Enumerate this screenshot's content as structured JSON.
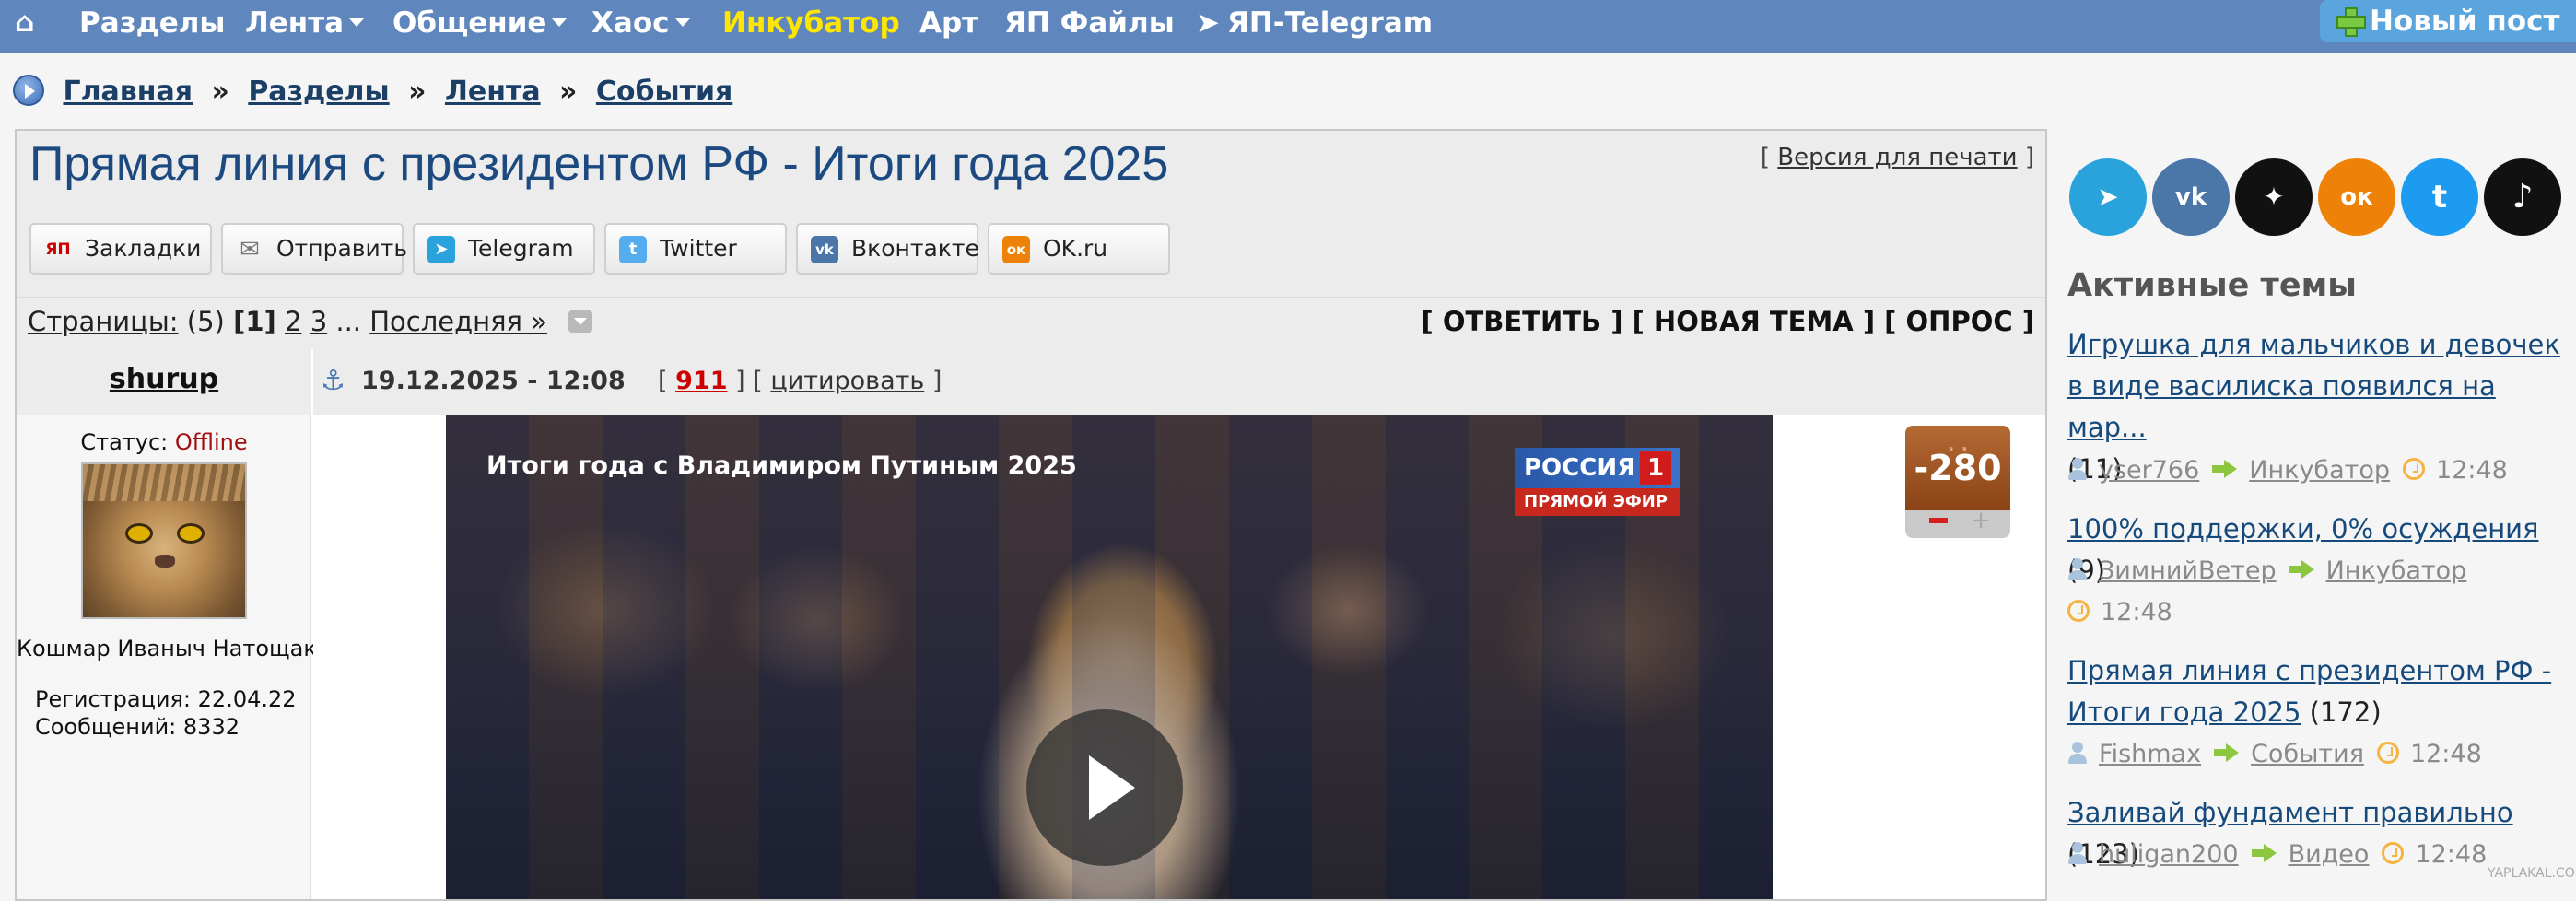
{
  "nav": {
    "items": [
      {
        "label": "Разделы",
        "has_caret": false
      },
      {
        "label": "Лента",
        "has_caret": true
      },
      {
        "label": "Общение",
        "has_caret": true
      },
      {
        "label": "Хаос",
        "has_caret": true
      },
      {
        "label": "Инкубатор",
        "has_caret": false,
        "highlight_color": "#ffe600"
      },
      {
        "label": "Арт",
        "has_caret": false
      },
      {
        "label": "ЯП Файлы",
        "has_caret": false
      },
      {
        "label": "ЯП-Telegram",
        "has_caret": false
      }
    ],
    "new_post_label": "Новый пост",
    "bar_color": "#5f86bd"
  },
  "breadcrumb": {
    "items": [
      "Главная",
      "Разделы",
      "Лента",
      "События"
    ],
    "separator": "»"
  },
  "post": {
    "title": "Прямая линия с президентом РФ - Итоги года 2025",
    "print_label": "Версия для печати",
    "share_buttons": [
      {
        "label": "Закладки",
        "icon": "yap-icon",
        "icon_text": "ЯП",
        "color": "#ffffff"
      },
      {
        "label": "Отправить",
        "icon": "envelope-icon",
        "icon_text": "✉",
        "color": "#ffffff"
      },
      {
        "label": "Telegram",
        "icon": "telegram-icon",
        "icon_text": "➤",
        "color": "#2aa3dc"
      },
      {
        "label": "Twitter",
        "icon": "twitter-icon",
        "icon_text": "t",
        "color": "#55acee"
      },
      {
        "label": "Вконтакте",
        "icon": "vk-icon",
        "icon_text": "vk",
        "color": "#4a76a8"
      },
      {
        "label": "OK.ru",
        "icon": "ok-icon",
        "icon_text": "ок",
        "color": "#ee8208"
      }
    ],
    "pages_label": "Страницы:",
    "pages_count": "(5)",
    "current_page": "1",
    "other_pages": [
      "2",
      "3"
    ],
    "ellipsis": "...",
    "last_label": "Последняя »",
    "actions": [
      "ОТВЕТИТЬ",
      "НОВАЯ ТЕМА",
      "ОПРОС"
    ],
    "author": {
      "name": "shurup",
      "status_label": "Статус:",
      "status_value": "Offline",
      "nickname": "Кошмар Иваныч Натощак",
      "registration": "Регистрация: 22.04.22",
      "messages": "Сообщений: 8332"
    },
    "date": "19.12.2025 - 12:08",
    "comments_count": "911",
    "quote_label": "цитировать",
    "video": {
      "title": "Итоги года с Владимиром Путиным 2025",
      "channel": "РОССИЯ",
      "channel_number": "1",
      "live_label": "ПРЯМОЙ ЭФИР"
    },
    "rating": "-280",
    "rating_color": "#a9551f"
  },
  "sidebar": {
    "socials": [
      {
        "name": "telegram",
        "icon": "telegram-icon",
        "color": "#2aa3dc",
        "glyph": "➤"
      },
      {
        "name": "vk",
        "icon": "vk-icon",
        "color": "#4a76a8",
        "glyph": "vk"
      },
      {
        "name": "dzen",
        "icon": "dzen-icon",
        "color": "#111111",
        "glyph": "✦"
      },
      {
        "name": "ok",
        "icon": "ok-icon",
        "color": "#ee8208",
        "glyph": "ок"
      },
      {
        "name": "twitter",
        "icon": "twitter-icon",
        "color": "#1d9bf0",
        "glyph": "t"
      },
      {
        "name": "tiktok",
        "icon": "tiktok-icon",
        "color": "#111111",
        "glyph": "♪"
      }
    ],
    "active_title": "Активные темы",
    "topics": [
      {
        "title": "Игрушка для мальчиков и девочек в виде василиска появился на мар...",
        "count": "(11)",
        "user": "yser766",
        "section": "Инкубатор",
        "time": "12:48"
      },
      {
        "title": "100% поддержки, 0% осуждения",
        "count": "(9)",
        "user": "ЗимнийВетер",
        "section": "Инкубатор",
        "time": "12:48"
      },
      {
        "title": "Прямая линия с президентом РФ - Итоги года 2025",
        "count": "(172)",
        "user": "Fishmax",
        "section": "События",
        "time": "12:48"
      },
      {
        "title": "Заливай фундамент правильно",
        "count": "(123)",
        "user": "huligan200",
        "section": "Видео",
        "time": "12:48"
      }
    ]
  },
  "watermark": "YAPLAKAL.COM"
}
